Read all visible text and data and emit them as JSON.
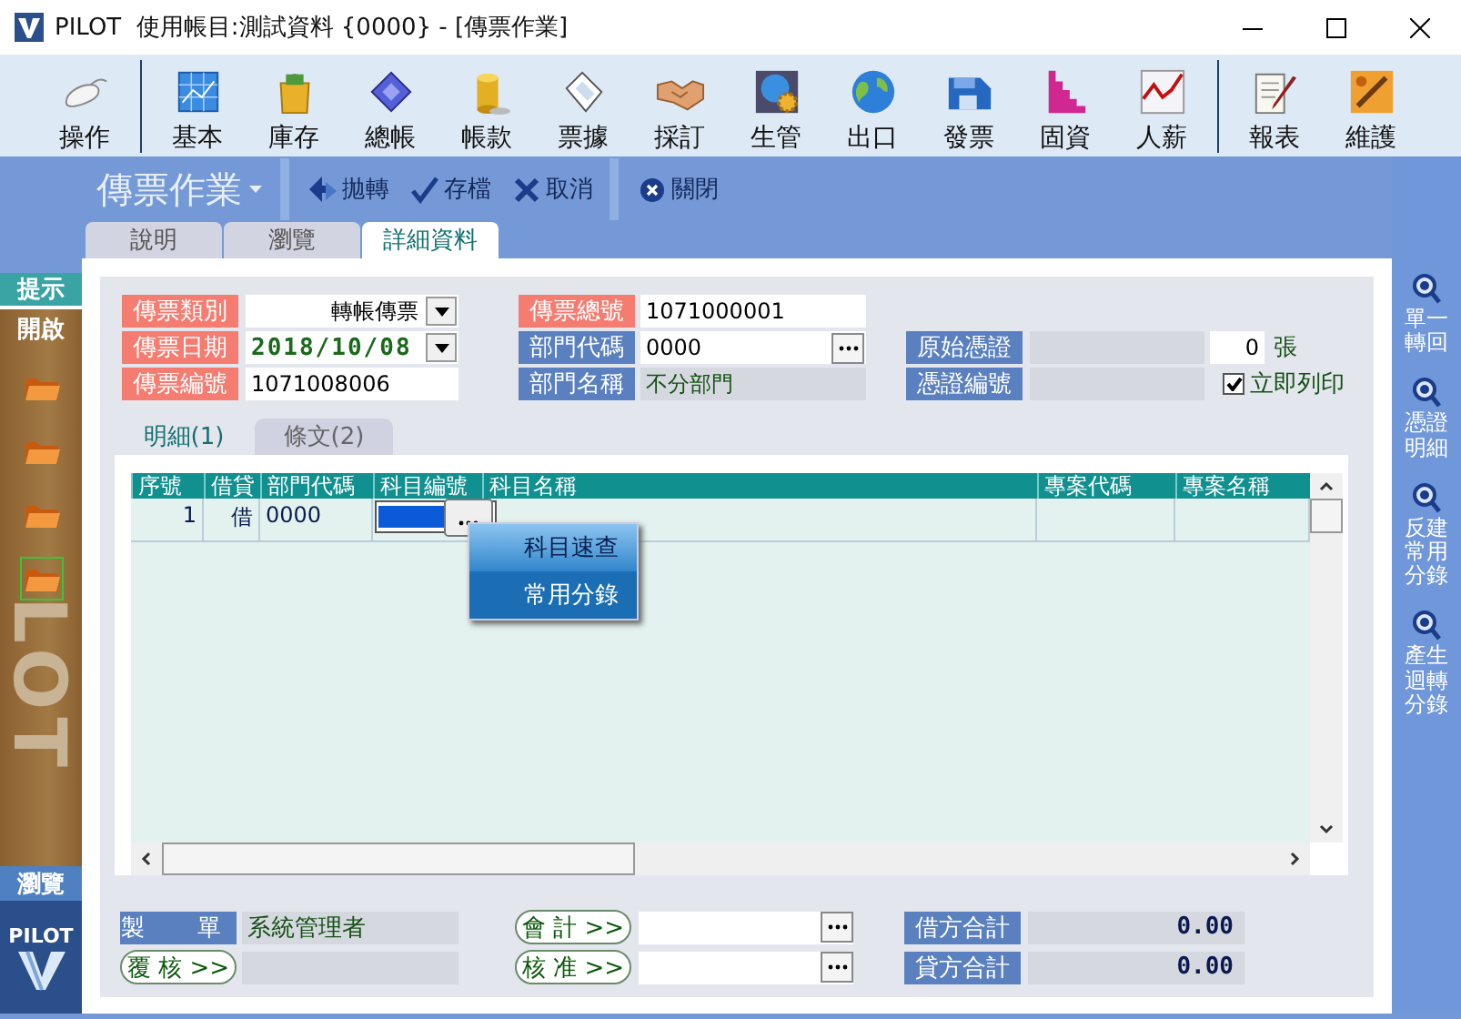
{
  "window": {
    "title": "PILOT  使用帳目:測試資料 {0000} - [傳票作業]"
  },
  "toolbar": {
    "groups": [
      {
        "items": [
          {
            "label": "操作"
          }
        ]
      },
      {
        "items": [
          {
            "label": "基本"
          },
          {
            "label": "庫存"
          },
          {
            "label": "總帳"
          },
          {
            "label": "帳款"
          },
          {
            "label": "票據"
          },
          {
            "label": "採訂"
          },
          {
            "label": "生管"
          },
          {
            "label": "出口"
          },
          {
            "label": "發票"
          },
          {
            "label": "固資"
          },
          {
            "label": "人薪"
          }
        ]
      },
      {
        "items": [
          {
            "label": "報表"
          },
          {
            "label": "維護"
          }
        ]
      }
    ]
  },
  "header": {
    "title": "傳票作業",
    "actions": [
      {
        "label": "拋轉"
      },
      {
        "label": "存檔"
      },
      {
        "label": "取消"
      },
      {
        "label": "關閉"
      }
    ]
  },
  "tabs": [
    {
      "label": "說明",
      "selected": false
    },
    {
      "label": "瀏覽",
      "selected": false
    },
    {
      "label": "詳細資料",
      "selected": true
    }
  ],
  "left_bar": {
    "hint": "提示",
    "open": "開啟",
    "folders": [
      {
        "selected": false
      },
      {
        "selected": false
      },
      {
        "selected": false
      },
      {
        "selected": true
      }
    ],
    "brand": "LOT",
    "browse": "瀏覽",
    "logo": "PILOT"
  },
  "right_bar": {
    "items": [
      {
        "label": "單一轉回"
      },
      {
        "label": "憑證明細"
      },
      {
        "label": "反建常用分錄"
      },
      {
        "label": "產生迴轉分錄"
      }
    ]
  },
  "form": {
    "type": {
      "label": "傳票類別",
      "value": "轉帳傳票",
      "required": true
    },
    "total_number": {
      "label": "傳票總號",
      "value": "1071000001",
      "required": true
    },
    "date": {
      "label": "傳票日期",
      "value": "2018/10/08",
      "required": true
    },
    "dept_code": {
      "label": "部門代碼",
      "value": "0000",
      "required": false
    },
    "original_doc": {
      "label": "原始憑證",
      "count": "0",
      "unit": "張",
      "required": false
    },
    "number": {
      "label": "傳票編號",
      "value": "1071008006",
      "required": true
    },
    "dept_name": {
      "label": "部門名稱",
      "value": "不分部門",
      "required": false
    },
    "doc_number": {
      "label": "憑證編號",
      "required": false
    },
    "print_now": {
      "label": "立即列印",
      "checked": true
    }
  },
  "detail_tabs": [
    {
      "label": "明細(1)",
      "selected": true
    },
    {
      "label": "條文(2)",
      "selected": false
    }
  ],
  "grid": {
    "columns": [
      "序號",
      "借貸",
      "部門代碼",
      "科目編號",
      "科目名稱",
      "專案代碼",
      "專案名稱"
    ],
    "rows": [
      {
        "seq": "1",
        "side": "借",
        "dept": "0000",
        "account_editing": true
      }
    ]
  },
  "context_menu": [
    {
      "label": "科目速查",
      "selected": true
    },
    {
      "label": "常用分錄",
      "selected": false
    }
  ],
  "footer": {
    "maker": {
      "label": "製　單",
      "value": "系統管理者"
    },
    "review": {
      "label": "覆 核 >>"
    },
    "accounting": {
      "label": "會 計 >>"
    },
    "approve": {
      "label": "核 准 >>"
    },
    "debit_total": {
      "label": "借方合計",
      "value": "0.00"
    },
    "credit_total": {
      "label": "貸方合計",
      "value": "0.00"
    }
  }
}
